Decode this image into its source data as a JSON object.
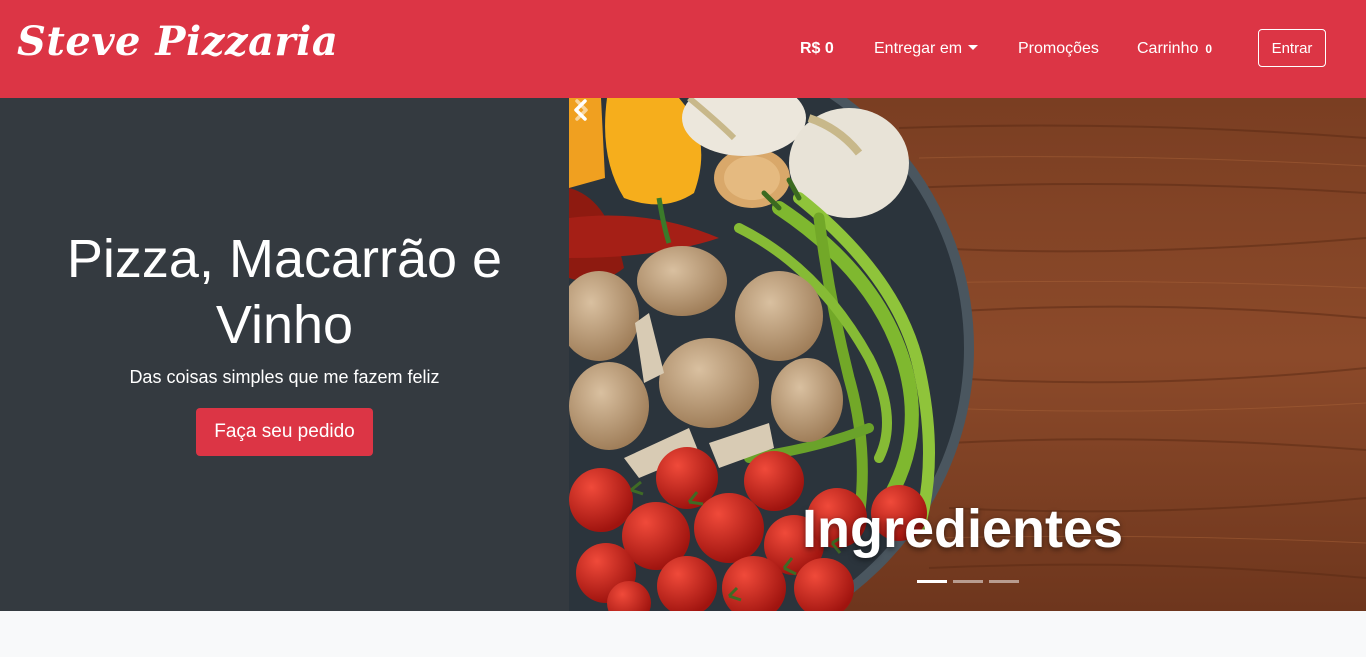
{
  "navbar": {
    "brand": "Steve Pizzaria",
    "price": "R$ 0",
    "deliver_label": "Entregar em",
    "promotions_label": "Promoções",
    "cart_label": "Carrinho",
    "cart_count": "0",
    "login_label": "Entrar",
    "color": "#dc3545"
  },
  "hero": {
    "title": "Pizza, Macarrão e Vinho",
    "subtitle": "Das coisas simples que me fazem feliz",
    "cta_label": "Faça seu pedido",
    "background": "#343a40"
  },
  "carousel": {
    "caption": "Ingredientes",
    "indicators": [
      true,
      false,
      false
    ],
    "prev_icon": "chevron-left-icon",
    "next_icon": "chevron-right-icon"
  }
}
